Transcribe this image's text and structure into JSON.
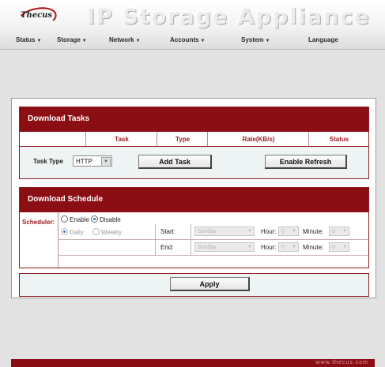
{
  "header": {
    "logo_text": "Thecus",
    "banner": "IP Storage Appliance"
  },
  "menu": [
    {
      "label": "Status",
      "caret": "▼"
    },
    {
      "label": "Storage",
      "caret": "▼"
    },
    {
      "label": "Network",
      "caret": "▼"
    },
    {
      "label": "Accounts",
      "caret": "▼"
    },
    {
      "label": "System",
      "caret": "▼"
    },
    {
      "label": "Language",
      "caret": ""
    }
  ],
  "tasks": {
    "title": "Download Tasks",
    "columns": [
      "Task",
      "Type",
      "Rate(KB/s)",
      "Status"
    ]
  },
  "toolbar": {
    "task_type_label": "Task Type",
    "task_type_value": "HTTP",
    "add_task": "Add Task",
    "enable_refresh": "Enable Refresh"
  },
  "schedule": {
    "title": "Download Schedule",
    "scheduler_label": "Scheduler:",
    "enable": "Enable",
    "disable": "Disable",
    "daily": "Daily",
    "weekly": "Weekly",
    "start_label": "Start:",
    "end_label": "End:",
    "day_value": "Sunday",
    "hour_label": "Hour:",
    "minute_label": "Minute:",
    "hour_value": "0",
    "minute_value": "0"
  },
  "apply": "Apply",
  "footer_text": "www.thecus.com"
}
